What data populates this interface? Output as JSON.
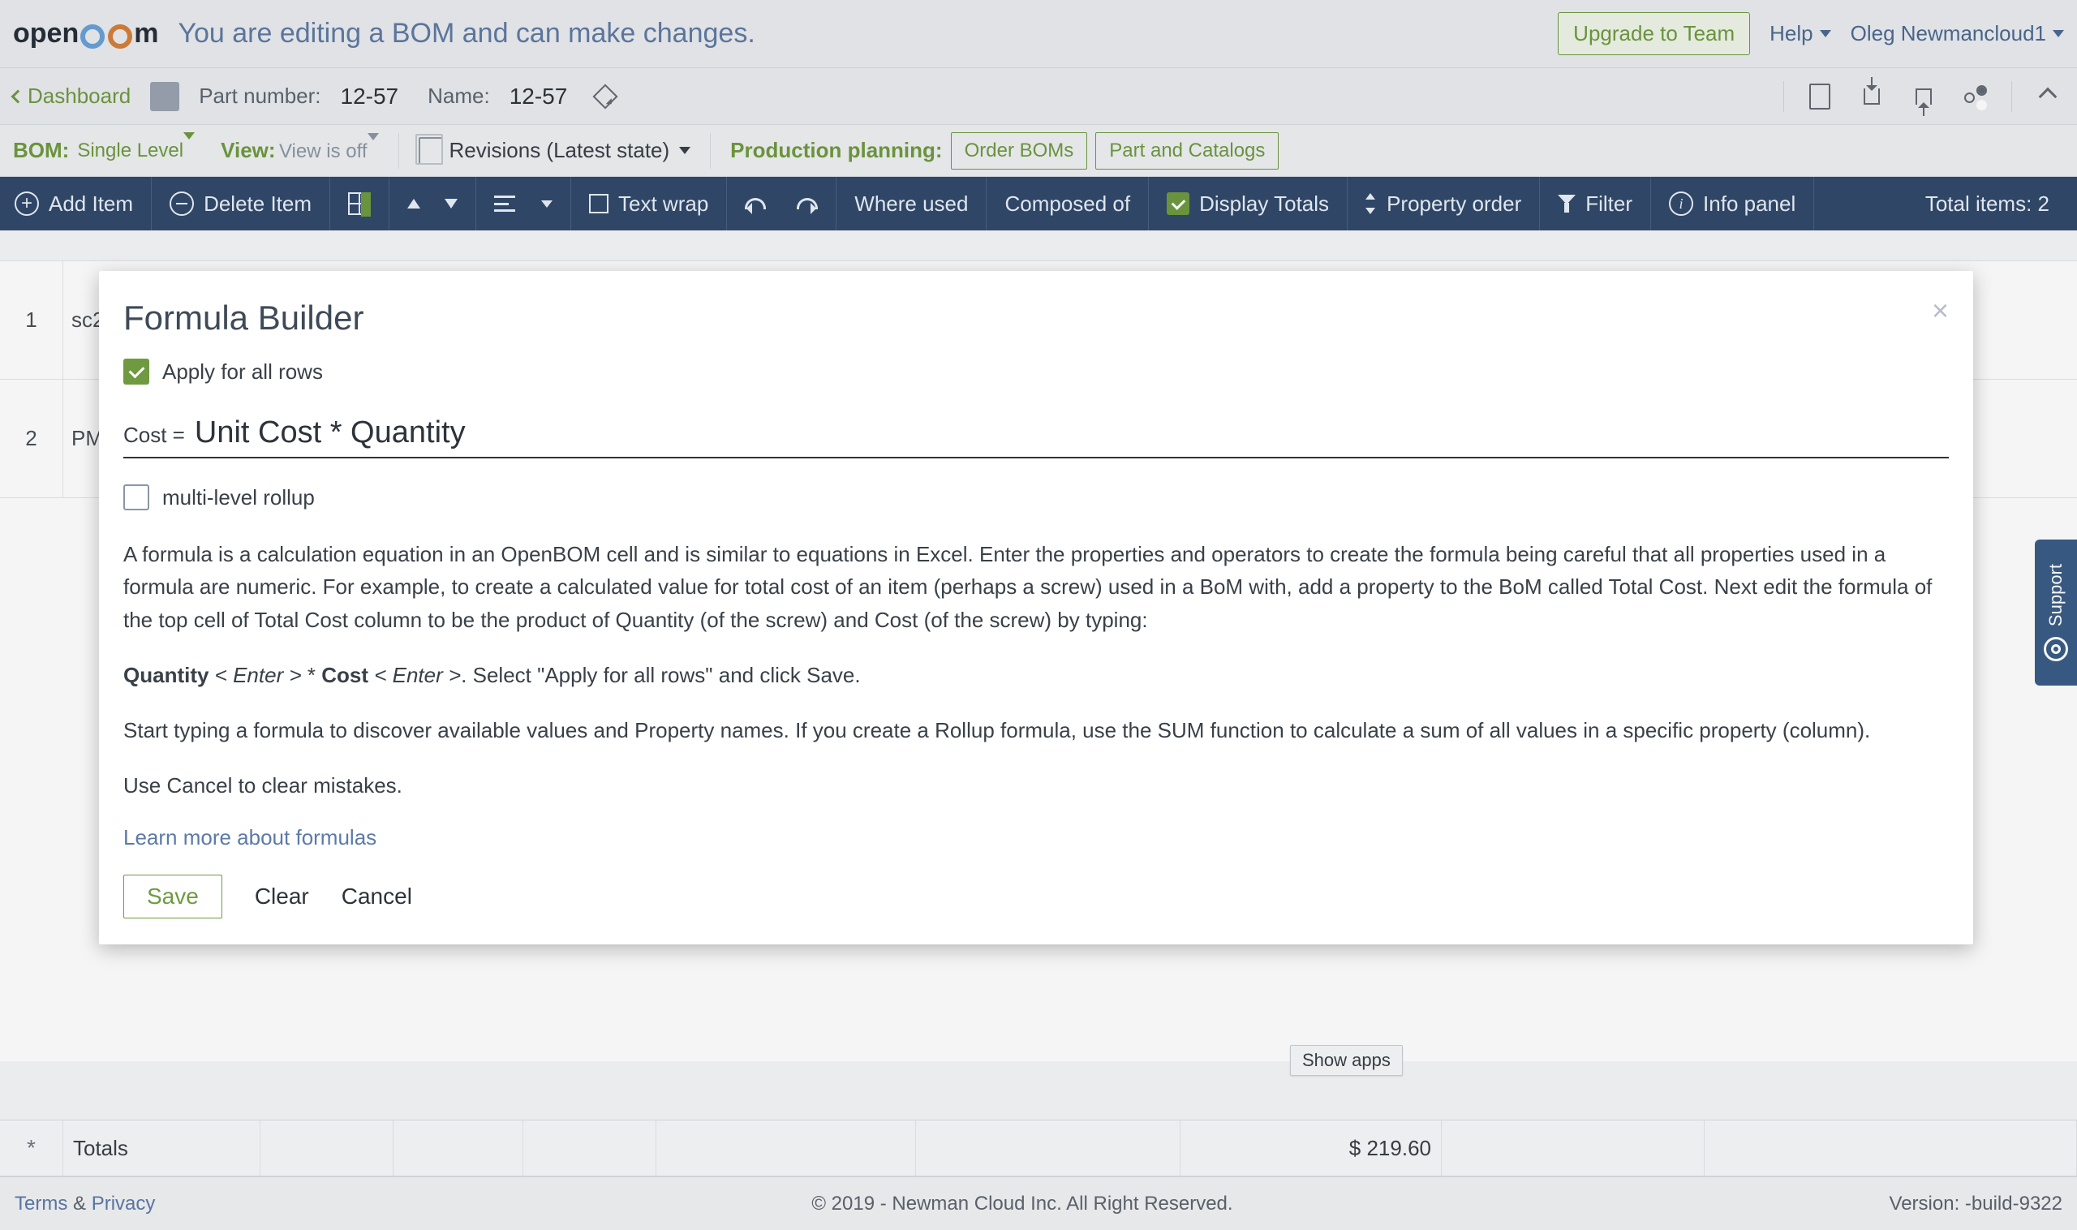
{
  "header": {
    "logo_text_left": "open",
    "logo_text_right": "m",
    "tagline": "You are editing a BOM and can make changes.",
    "upgrade": "Upgrade to Team",
    "help": "Help",
    "user": "Oleg Newmancloud1"
  },
  "subheader": {
    "dashboard": "Dashboard",
    "part_number_label": "Part number:",
    "part_number": "12-57",
    "name_label": "Name:",
    "name": "12-57"
  },
  "bombar": {
    "bom_label": "BOM:",
    "bom_value": "Single Level",
    "view_label": "View:",
    "view_value": "View is off",
    "revisions": "Revisions (Latest state)",
    "planning_label": "Production planning:",
    "order_boms": "Order BOMs",
    "part_catalogs": "Part and Catalogs"
  },
  "toolbar": {
    "add": "Add Item",
    "delete": "Delete Item",
    "wrap": "Text wrap",
    "where": "Where used",
    "composed": "Composed of",
    "totals": "Display Totals",
    "order": "Property order",
    "filter": "Filter",
    "info": "Info panel",
    "total_items": "Total items: 2"
  },
  "grid": {
    "rows": [
      {
        "n": "1",
        "first": "sc2"
      },
      {
        "n": "2",
        "first": "PM"
      }
    ]
  },
  "totals": {
    "star": "*",
    "label": "Totals",
    "cost": "$ 219.60"
  },
  "support": "Support",
  "show_apps": "Show apps",
  "footer": {
    "terms": "Terms",
    "amp": " & ",
    "privacy": "Privacy",
    "copyright": "© 2019 - Newman Cloud Inc. All Right Reserved.",
    "version": "Version: -build-9322"
  },
  "modal": {
    "title": "Formula Builder",
    "apply_all": "Apply for all rows",
    "lhs": "Cost =",
    "rhs": "Unit Cost * Quantity",
    "multi_rollup": "multi-level rollup",
    "p1": "A formula is a calculation equation in an OpenBOM cell and is similar to equations in Excel. Enter the properties and operators to create the formula being careful that all properties used in a formula are numeric. For example, to create a calculated value for total cost of an item (perhaps a screw) used in a BoM with, add a property to the BoM called Total Cost. Next edit the formula of the top cell of Total Cost column to be the product of Quantity (of the screw) and Cost (of the screw) by typing:",
    "p2_q": "Quantity",
    "p2_e1": " < Enter > ",
    "p2_star": "* ",
    "p2_c": "Cost",
    "p2_e2": " < Enter >",
    "p2_tail": ". Select \"Apply for all rows\" and click Save.",
    "p3": "Start typing a formula to discover available values and Property names. If you create a Rollup formula, use the SUM function to calculate a sum of all values in a specific property (column).",
    "p4": "Use Cancel to clear mistakes.",
    "learn": "Learn more about formulas",
    "save": "Save",
    "clear": "Clear",
    "cancel": "Cancel"
  }
}
